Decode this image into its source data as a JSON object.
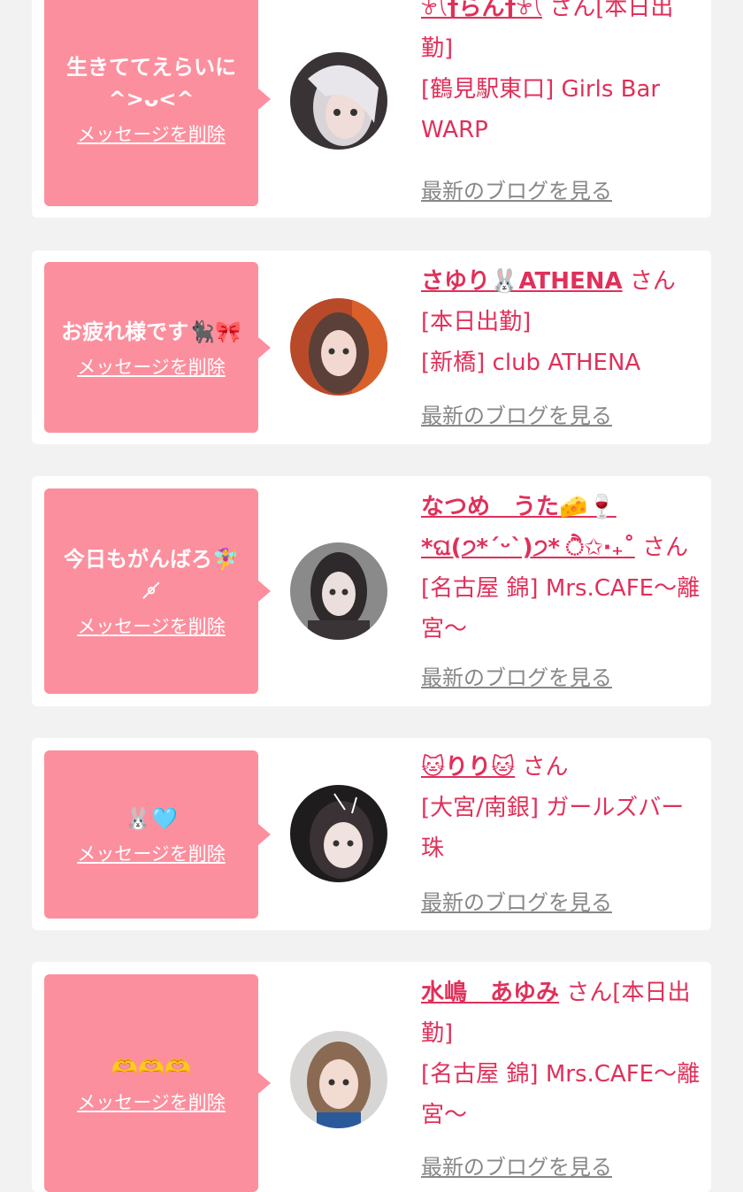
{
  "cards": [
    {
      "message": "生きててえらいに ^>ᴗ<^",
      "delete_label": "メッセージを削除",
      "name": "𓍯†らん†𓍯",
      "san": "さん",
      "status": "[本日出勤]",
      "shop": "[鶴見駅東口] Girls Bar WARP",
      "blog_label": "最新のブログを見る"
    },
    {
      "message": "お疲れ様です🐈‍⬛🎀",
      "delete_label": "メッセージを削除",
      "name": "さゆり🐰ATHENA",
      "san": "さん",
      "status": "[本日出勤]",
      "shop": "[新橋] club ATHENA",
      "blog_label": "最新のブログを見る"
    },
    {
      "message": "今日もがんばろ🧚‍♀️ ⚬̸",
      "delete_label": "メッセージを削除",
      "name": "なつめ　うた🧀🍷 *ଘ(੭*ˊᵕˋ)੭* ੈ✩‧₊˚",
      "san": "さん",
      "status": "",
      "shop": "[名古屋 錦] Mrs.CAFE〜離宮〜",
      "blog_label": "最新のブログを見る"
    },
    {
      "message": "🐰🩵",
      "delete_label": "メッセージを削除",
      "name": "🐱りり🐱",
      "san": "さん",
      "status": "",
      "shop": "[大宮/南銀] ガールズバー 珠",
      "blog_label": "最新のブログを見る"
    },
    {
      "message": "🫶🫶🫶",
      "delete_label": "メッセージを削除",
      "name": "水嶋　あゆみ",
      "san": "さん",
      "status": "[本日出勤]",
      "shop": "[名古屋 錦] Mrs.CAFE〜離宮〜",
      "blog_label": "最新のブログを見る"
    }
  ]
}
